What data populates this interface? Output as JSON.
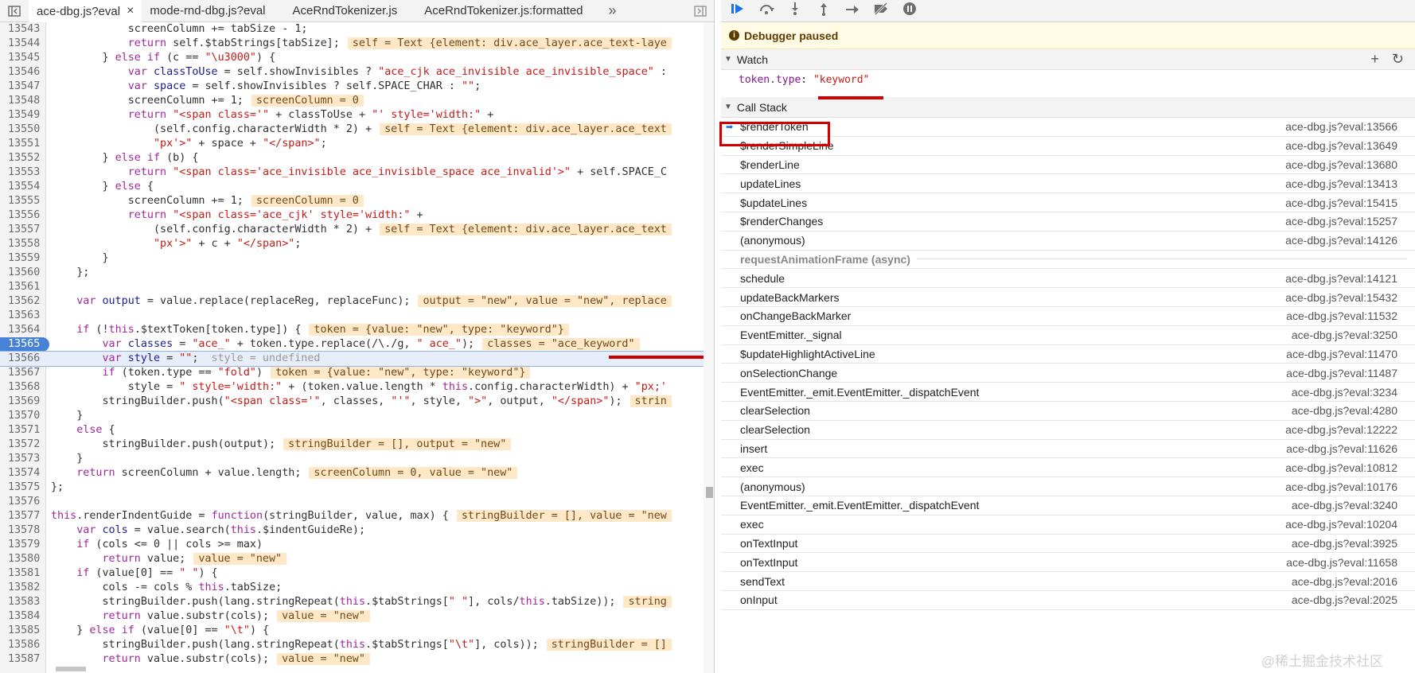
{
  "tabs": [
    "ace-dbg.js?eval",
    "mode-rnd-dbg.js?eval",
    "AceRndTokenizer.js",
    "AceRndTokenizer.js:formatted"
  ],
  "tab_close": "×",
  "tab_more": "»",
  "code": [
    {
      "n": "13543",
      "t": [
        {
          "c": "",
          "v": "            screenColumn += tabSize - 1;"
        }
      ]
    },
    {
      "n": "13544",
      "t": [
        {
          "c": "",
          "v": "            "
        },
        {
          "c": "kw",
          "v": "return"
        },
        {
          "c": "",
          "v": " self.$tabStrings[tabSize];"
        },
        {
          "c": "iv",
          "v": "self = Text {element: div.ace_layer.ace_text-laye"
        }
      ]
    },
    {
      "n": "13545",
      "t": [
        {
          "c": "",
          "v": "        } "
        },
        {
          "c": "kw",
          "v": "else if"
        },
        {
          "c": "",
          "v": " (c == "
        },
        {
          "c": "st",
          "v": "\"\\u3000\""
        },
        {
          "c": "",
          "v": ") {"
        }
      ]
    },
    {
      "n": "13546",
      "t": [
        {
          "c": "",
          "v": "            "
        },
        {
          "c": "kw",
          "v": "var"
        },
        {
          "c": "vr",
          "v": " classToUse"
        },
        {
          "c": "",
          "v": " = self.showInvisibles ? "
        },
        {
          "c": "st",
          "v": "\"ace_cjk ace_invisible ace_invisible_space\""
        },
        {
          "c": "",
          "v": " :"
        }
      ]
    },
    {
      "n": "13547",
      "t": [
        {
          "c": "",
          "v": "            "
        },
        {
          "c": "kw",
          "v": "var"
        },
        {
          "c": "vr",
          "v": " space"
        },
        {
          "c": "",
          "v": " = self.showInvisibles ? self.SPACE_CHAR : "
        },
        {
          "c": "st",
          "v": "\"\""
        },
        {
          "c": "",
          "v": ";"
        }
      ]
    },
    {
      "n": "13548",
      "t": [
        {
          "c": "",
          "v": "            screenColumn += 1;"
        },
        {
          "c": "iv",
          "v": "screenColumn = 0"
        }
      ]
    },
    {
      "n": "13549",
      "t": [
        {
          "c": "",
          "v": "            "
        },
        {
          "c": "kw",
          "v": "return"
        },
        {
          "c": "st",
          "v": " \"<span class='\""
        },
        {
          "c": "",
          "v": " + classToUse + "
        },
        {
          "c": "st",
          "v": "\"' style='width:\""
        },
        {
          "c": "",
          "v": " +"
        }
      ]
    },
    {
      "n": "13550",
      "t": [
        {
          "c": "",
          "v": "                (self.config.characterWidth * 2) +"
        },
        {
          "c": "iv",
          "v": "self = Text {element: div.ace_layer.ace_text"
        }
      ]
    },
    {
      "n": "13551",
      "t": [
        {
          "c": "",
          "v": "                "
        },
        {
          "c": "st",
          "v": "\"px'>\""
        },
        {
          "c": "",
          "v": " + space + "
        },
        {
          "c": "st",
          "v": "\"</span>\""
        },
        {
          "c": "",
          "v": ";"
        }
      ]
    },
    {
      "n": "13552",
      "t": [
        {
          "c": "",
          "v": "        } "
        },
        {
          "c": "kw",
          "v": "else if"
        },
        {
          "c": "",
          "v": " (b) {"
        }
      ]
    },
    {
      "n": "13553",
      "t": [
        {
          "c": "",
          "v": "            "
        },
        {
          "c": "kw",
          "v": "return"
        },
        {
          "c": "st",
          "v": " \"<span class='ace_invisible ace_invisible_space ace_invalid'>\""
        },
        {
          "c": "",
          "v": " + self.SPACE_C"
        }
      ]
    },
    {
      "n": "13554",
      "t": [
        {
          "c": "",
          "v": "        } "
        },
        {
          "c": "kw",
          "v": "else"
        },
        {
          "c": "",
          "v": " {"
        }
      ]
    },
    {
      "n": "13555",
      "t": [
        {
          "c": "",
          "v": "            screenColumn += 1;"
        },
        {
          "c": "iv",
          "v": "screenColumn = 0"
        }
      ]
    },
    {
      "n": "13556",
      "t": [
        {
          "c": "",
          "v": "            "
        },
        {
          "c": "kw",
          "v": "return"
        },
        {
          "c": "st",
          "v": " \"<span class='ace_cjk' style='width:\""
        },
        {
          "c": "",
          "v": " +"
        }
      ]
    },
    {
      "n": "13557",
      "t": [
        {
          "c": "",
          "v": "                (self.config.characterWidth * 2) +"
        },
        {
          "c": "iv",
          "v": "self = Text {element: div.ace_layer.ace_text"
        }
      ]
    },
    {
      "n": "13558",
      "t": [
        {
          "c": "",
          "v": "                "
        },
        {
          "c": "st",
          "v": "\"px'>\""
        },
        {
          "c": "",
          "v": " + c + "
        },
        {
          "c": "st",
          "v": "\"</span>\""
        },
        {
          "c": "",
          "v": ";"
        }
      ]
    },
    {
      "n": "13559",
      "t": [
        {
          "c": "",
          "v": "        }"
        }
      ]
    },
    {
      "n": "13560",
      "t": [
        {
          "c": "",
          "v": "    };"
        }
      ]
    },
    {
      "n": "13561",
      "t": [
        {
          "c": "",
          "v": ""
        }
      ]
    },
    {
      "n": "13562",
      "t": [
        {
          "c": "",
          "v": "    "
        },
        {
          "c": "kw",
          "v": "var"
        },
        {
          "c": "vr",
          "v": " output"
        },
        {
          "c": "",
          "v": " = value.replace(replaceReg, replaceFunc);"
        },
        {
          "c": "iv",
          "v": "output = \"new\", value = \"new\", replace"
        }
      ]
    },
    {
      "n": "13563",
      "t": [
        {
          "c": "",
          "v": ""
        }
      ]
    },
    {
      "n": "13564",
      "t": [
        {
          "c": "",
          "v": "    "
        },
        {
          "c": "kw",
          "v": "if"
        },
        {
          "c": "",
          "v": " (!"
        },
        {
          "c": "kw",
          "v": "this"
        },
        {
          "c": "",
          "v": ".$textToken[token.type]) {"
        },
        {
          "c": "iv",
          "v": "token = {value: \"new\", type: \"keyword\"}"
        }
      ]
    },
    {
      "n": "13565",
      "bp": true,
      "t": [
        {
          "c": "",
          "v": "        "
        },
        {
          "c": "kw",
          "v": "var"
        },
        {
          "c": "vr",
          "v": " classes"
        },
        {
          "c": "",
          "v": " = "
        },
        {
          "c": "st",
          "v": "\"ace_\""
        },
        {
          "c": "",
          "v": " + token.type.replace(/\\./g, "
        },
        {
          "c": "st",
          "v": "\" ace_\""
        },
        {
          "c": "",
          "v": ");"
        },
        {
          "c": "iv",
          "v": "classes = \"ace_keyword\""
        }
      ]
    },
    {
      "n": "13566",
      "cur": true,
      "t": [
        {
          "c": "",
          "v": "        "
        },
        {
          "c": "kw",
          "v": "var"
        },
        {
          "c": "vr",
          "v": " style"
        },
        {
          "c": "",
          "v": " = "
        },
        {
          "c": "st",
          "v": "\"\""
        },
        {
          "c": "",
          "v": ";"
        },
        {
          "c": "iv gr",
          "v": "style = undefined"
        }
      ]
    },
    {
      "n": "13567",
      "t": [
        {
          "c": "",
          "v": "        "
        },
        {
          "c": "kw",
          "v": "if"
        },
        {
          "c": "",
          "v": " (token.type == "
        },
        {
          "c": "st",
          "v": "\"fold\""
        },
        {
          "c": "",
          "v": ")"
        },
        {
          "c": "iv",
          "v": "token = {value: \"new\", type: \"keyword\"}"
        }
      ]
    },
    {
      "n": "13568",
      "t": [
        {
          "c": "",
          "v": "            style = "
        },
        {
          "c": "st",
          "v": "\" style='width:\""
        },
        {
          "c": "",
          "v": " + (token.value.length * "
        },
        {
          "c": "kw",
          "v": "this"
        },
        {
          "c": "",
          "v": ".config.characterWidth) + "
        },
        {
          "c": "st",
          "v": "\"px;'"
        }
      ]
    },
    {
      "n": "13569",
      "t": [
        {
          "c": "",
          "v": "        stringBuilder.push("
        },
        {
          "c": "st",
          "v": "\"<span class='\""
        },
        {
          "c": "",
          "v": ", classes, "
        },
        {
          "c": "st",
          "v": "\"'\""
        },
        {
          "c": "",
          "v": ", style, "
        },
        {
          "c": "st",
          "v": "\">\""
        },
        {
          "c": "",
          "v": ", output, "
        },
        {
          "c": "st",
          "v": "\"</span>\""
        },
        {
          "c": "",
          "v": ");"
        },
        {
          "c": "iv",
          "v": "strin"
        }
      ]
    },
    {
      "n": "13570",
      "t": [
        {
          "c": "",
          "v": "    }"
        }
      ]
    },
    {
      "n": "13571",
      "t": [
        {
          "c": "",
          "v": "    "
        },
        {
          "c": "kw",
          "v": "else"
        },
        {
          "c": "",
          "v": " {"
        }
      ]
    },
    {
      "n": "13572",
      "t": [
        {
          "c": "",
          "v": "        stringBuilder.push(output);"
        },
        {
          "c": "iv",
          "v": "stringBuilder = [], output = \"new\""
        }
      ]
    },
    {
      "n": "13573",
      "t": [
        {
          "c": "",
          "v": "    }"
        }
      ]
    },
    {
      "n": "13574",
      "t": [
        {
          "c": "",
          "v": "    "
        },
        {
          "c": "kw",
          "v": "return"
        },
        {
          "c": "",
          "v": " screenColumn + value.length;"
        },
        {
          "c": "iv",
          "v": "screenColumn = 0, value = \"new\""
        }
      ]
    },
    {
      "n": "13575",
      "t": [
        {
          "c": "",
          "v": "};"
        }
      ]
    },
    {
      "n": "13576",
      "t": [
        {
          "c": "",
          "v": ""
        }
      ]
    },
    {
      "n": "13577",
      "t": [
        {
          "c": "kw",
          "v": "this"
        },
        {
          "c": "",
          "v": ".renderIndentGuide = "
        },
        {
          "c": "kw",
          "v": "function"
        },
        {
          "c": "",
          "v": "(stringBuilder, value, max) {"
        },
        {
          "c": "iv",
          "v": "stringBuilder = [], value = \"new"
        }
      ]
    },
    {
      "n": "13578",
      "t": [
        {
          "c": "",
          "v": "    "
        },
        {
          "c": "kw",
          "v": "var"
        },
        {
          "c": "vr",
          "v": " cols"
        },
        {
          "c": "",
          "v": " = value.search("
        },
        {
          "c": "kw",
          "v": "this"
        },
        {
          "c": "",
          "v": ".$indentGuideRe);"
        }
      ]
    },
    {
      "n": "13579",
      "t": [
        {
          "c": "",
          "v": "    "
        },
        {
          "c": "kw",
          "v": "if"
        },
        {
          "c": "",
          "v": " (cols <= 0 || cols >= max)"
        }
      ]
    },
    {
      "n": "13580",
      "t": [
        {
          "c": "",
          "v": "        "
        },
        {
          "c": "kw",
          "v": "return"
        },
        {
          "c": "",
          "v": " value;"
        },
        {
          "c": "iv",
          "v": "value = \"new\""
        }
      ]
    },
    {
      "n": "13581",
      "t": [
        {
          "c": "",
          "v": "    "
        },
        {
          "c": "kw",
          "v": "if"
        },
        {
          "c": "",
          "v": " (value[0] == "
        },
        {
          "c": "st",
          "v": "\" \""
        },
        {
          "c": "",
          "v": ") {"
        }
      ]
    },
    {
      "n": "13582",
      "t": [
        {
          "c": "",
          "v": "        cols -= cols % "
        },
        {
          "c": "kw",
          "v": "this"
        },
        {
          "c": "",
          "v": ".tabSize;"
        }
      ]
    },
    {
      "n": "13583",
      "t": [
        {
          "c": "",
          "v": "        stringBuilder.push(lang.stringRepeat("
        },
        {
          "c": "kw",
          "v": "this"
        },
        {
          "c": "",
          "v": ".$tabStrings["
        },
        {
          "c": "st",
          "v": "\" \""
        },
        {
          "c": "",
          "v": "], cols/"
        },
        {
          "c": "kw",
          "v": "this"
        },
        {
          "c": "",
          "v": ".tabSize));"
        },
        {
          "c": "iv",
          "v": "string"
        }
      ]
    },
    {
      "n": "13584",
      "t": [
        {
          "c": "",
          "v": "        "
        },
        {
          "c": "kw",
          "v": "return"
        },
        {
          "c": "",
          "v": " value.substr(cols);"
        },
        {
          "c": "iv",
          "v": "value = \"new\""
        }
      ]
    },
    {
      "n": "13585",
      "t": [
        {
          "c": "",
          "v": "    } "
        },
        {
          "c": "kw",
          "v": "else if"
        },
        {
          "c": "",
          "v": " (value[0] == "
        },
        {
          "c": "st",
          "v": "\"\\t\""
        },
        {
          "c": "",
          "v": ") {"
        }
      ]
    },
    {
      "n": "13586",
      "t": [
        {
          "c": "",
          "v": "        stringBuilder.push(lang.stringRepeat("
        },
        {
          "c": "kw",
          "v": "this"
        },
        {
          "c": "",
          "v": ".$tabStrings["
        },
        {
          "c": "st",
          "v": "\"\\t\""
        },
        {
          "c": "",
          "v": "], cols));"
        },
        {
          "c": "iv",
          "v": "stringBuilder = []"
        }
      ]
    },
    {
      "n": "13587",
      "t": [
        {
          "c": "",
          "v": "        "
        },
        {
          "c": "kw",
          "v": "return"
        },
        {
          "c": "",
          "v": " value.substr(cols);"
        },
        {
          "c": "iv",
          "v": "value = \"new\""
        }
      ]
    }
  ],
  "debugger": {
    "paused": "Debugger paused",
    "watch_title": "Watch",
    "watch_expr": "token.type",
    "watch_value": "\"keyword\"",
    "callstack_title": "Call Stack",
    "frames_a": [
      {
        "fn": "$renderToken",
        "loc": "ace-dbg.js?eval:13566",
        "current": true
      },
      {
        "fn": "$renderSimpleLine",
        "loc": "ace-dbg.js?eval:13649"
      },
      {
        "fn": "$renderLine",
        "loc": "ace-dbg.js?eval:13680"
      },
      {
        "fn": "updateLines",
        "loc": "ace-dbg.js?eval:13413"
      },
      {
        "fn": "$updateLines",
        "loc": "ace-dbg.js?eval:15415"
      },
      {
        "fn": "$renderChanges",
        "loc": "ace-dbg.js?eval:15257"
      },
      {
        "fn": "(anonymous)",
        "loc": "ace-dbg.js?eval:14126"
      }
    ],
    "async_label": "requestAnimationFrame (async)",
    "frames_b": [
      {
        "fn": "schedule",
        "loc": "ace-dbg.js?eval:14121"
      },
      {
        "fn": "updateBackMarkers",
        "loc": "ace-dbg.js?eval:15432"
      },
      {
        "fn": "onChangeBackMarker",
        "loc": "ace-dbg.js?eval:11532"
      },
      {
        "fn": "EventEmitter._signal",
        "loc": "ace-dbg.js?eval:3250"
      },
      {
        "fn": "$updateHighlightActiveLine",
        "loc": "ace-dbg.js?eval:11470"
      },
      {
        "fn": "onSelectionChange",
        "loc": "ace-dbg.js?eval:11487"
      },
      {
        "fn": "EventEmitter._emit.EventEmitter._dispatchEvent",
        "loc": "ace-dbg.js?eval:3234"
      },
      {
        "fn": "clearSelection",
        "loc": "ace-dbg.js?eval:4280"
      },
      {
        "fn": "clearSelection",
        "loc": "ace-dbg.js?eval:12222"
      },
      {
        "fn": "insert",
        "loc": "ace-dbg.js?eval:11626"
      },
      {
        "fn": "exec",
        "loc": "ace-dbg.js?eval:10812"
      },
      {
        "fn": "(anonymous)",
        "loc": "ace-dbg.js?eval:10176"
      },
      {
        "fn": "EventEmitter._emit.EventEmitter._dispatchEvent",
        "loc": "ace-dbg.js?eval:3240"
      },
      {
        "fn": "exec",
        "loc": "ace-dbg.js?eval:10204"
      },
      {
        "fn": "onTextInput",
        "loc": "ace-dbg.js?eval:3925"
      },
      {
        "fn": "onTextInput",
        "loc": "ace-dbg.js?eval:11658"
      },
      {
        "fn": "sendText",
        "loc": "ace-dbg.js?eval:2016"
      },
      {
        "fn": "onInput",
        "loc": "ace-dbg.js?eval:2025"
      }
    ]
  },
  "watermark": "@稀土掘金技术社区",
  "accent": "#1a73e8",
  "annotation_color": "#d10000"
}
